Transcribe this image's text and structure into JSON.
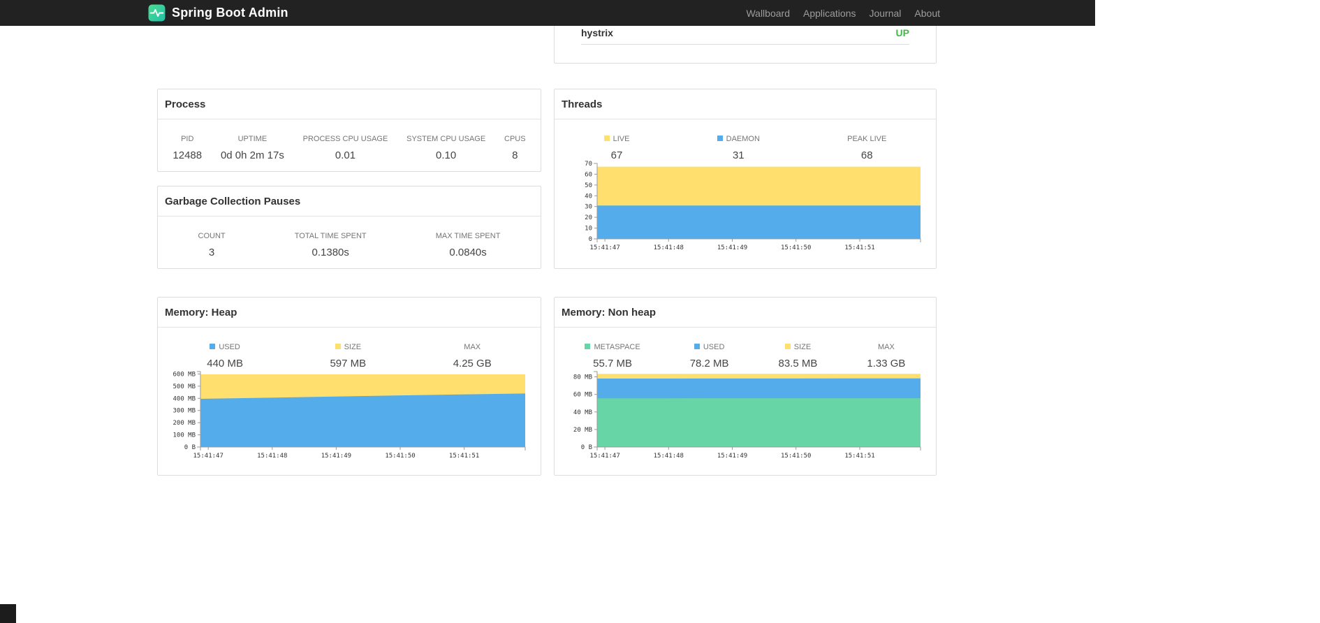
{
  "navbar": {
    "brand": "Spring Boot Admin",
    "brand_icon": "pulse-logo-icon",
    "links": [
      {
        "label": "Wallboard"
      },
      {
        "label": "Applications"
      },
      {
        "label": "Journal"
      },
      {
        "label": "About"
      }
    ]
  },
  "health": {
    "items": [
      {
        "name": "hystrix",
        "status": "UP"
      }
    ]
  },
  "colors": {
    "navbar_bg": "#222222",
    "status_up": "#43b749",
    "chart_blue": "#55aceb",
    "chart_yellow": "#ffe06e",
    "chart_green": "#67d5a6"
  },
  "panels": {
    "process": {
      "title": "Process",
      "metrics": [
        {
          "label": "PID",
          "value": "12488"
        },
        {
          "label": "UPTIME",
          "value": "0d 0h 2m 17s"
        },
        {
          "label": "PROCESS CPU USAGE",
          "value": "0.01"
        },
        {
          "label": "SYSTEM CPU USAGE",
          "value": "0.10"
        },
        {
          "label": "CPUS",
          "value": "8"
        }
      ]
    },
    "gc": {
      "title": "Garbage Collection Pauses",
      "metrics": [
        {
          "label": "COUNT",
          "value": "3"
        },
        {
          "label": "TOTAL TIME SPENT",
          "value": "0.1380s"
        },
        {
          "label": "MAX TIME SPENT",
          "value": "0.0840s"
        }
      ]
    },
    "threads": {
      "title": "Threads",
      "metrics": [
        {
          "label": "LIVE",
          "value": "67",
          "color": "#ffe06e"
        },
        {
          "label": "DAEMON",
          "value": "31",
          "color": "#55aceb"
        },
        {
          "label": "PEAK LIVE",
          "value": "68"
        }
      ]
    },
    "heap": {
      "title": "Memory: Heap",
      "metrics": [
        {
          "label": "USED",
          "value": "440 MB",
          "color": "#55aceb"
        },
        {
          "label": "SIZE",
          "value": "597 MB",
          "color": "#ffe06e"
        },
        {
          "label": "MAX",
          "value": "4.25 GB"
        }
      ]
    },
    "nonheap": {
      "title": "Memory: Non heap",
      "metrics": [
        {
          "label": "METASPACE",
          "value": "55.7 MB",
          "color": "#67d5a6"
        },
        {
          "label": "USED",
          "value": "78.2 MB",
          "color": "#55aceb"
        },
        {
          "label": "SIZE",
          "value": "83.5 MB",
          "color": "#ffe06e"
        },
        {
          "label": "MAX",
          "value": "1.33 GB"
        }
      ]
    }
  },
  "chart_data": [
    {
      "id": "threads",
      "type": "area",
      "title": "Threads",
      "x": [
        "15:41:47",
        "15:41:48",
        "15:41:49",
        "15:41:50",
        "15:41:51"
      ],
      "xlabel": "",
      "ylabel": "",
      "ylim": [
        0,
        70
      ],
      "y_ticks": [
        0,
        10,
        20,
        30,
        40,
        50,
        60,
        70
      ],
      "y_tick_labels": [
        "0",
        "10",
        "20",
        "30",
        "40",
        "50",
        "60",
        "70"
      ],
      "grid": false,
      "legend_position": "top",
      "series": [
        {
          "name": "LIVE",
          "color": "#ffe06e",
          "values": [
            67,
            67,
            67,
            67,
            67,
            67
          ]
        },
        {
          "name": "DAEMON",
          "color": "#55aceb",
          "values": [
            31,
            31,
            31,
            31,
            31,
            31
          ]
        }
      ]
    },
    {
      "id": "memory-heap",
      "type": "area",
      "title": "Memory: Heap",
      "x": [
        "15:41:47",
        "15:41:48",
        "15:41:49",
        "15:41:50",
        "15:41:51"
      ],
      "xlabel": "",
      "ylabel": "MB",
      "ylim": [
        0,
        620
      ],
      "y_ticks": [
        0,
        100,
        200,
        300,
        400,
        500,
        600
      ],
      "y_tick_labels": [
        "0 B",
        "100 MB",
        "200 MB",
        "300 MB",
        "400 MB",
        "500 MB",
        "600 MB"
      ],
      "grid": false,
      "legend_position": "top",
      "series": [
        {
          "name": "SIZE",
          "color": "#ffe06e",
          "values": [
            597,
            597,
            597,
            597,
            597,
            597
          ]
        },
        {
          "name": "USED",
          "color": "#55aceb",
          "values": [
            396,
            405,
            414,
            423,
            432,
            440
          ]
        }
      ]
    },
    {
      "id": "memory-nonheap",
      "type": "area",
      "title": "Memory: Non heap",
      "x": [
        "15:41:47",
        "15:41:48",
        "15:41:49",
        "15:41:50",
        "15:41:51"
      ],
      "xlabel": "",
      "ylabel": "MB",
      "ylim": [
        0,
        86
      ],
      "y_ticks": [
        0,
        20,
        40,
        60,
        80
      ],
      "y_tick_labels": [
        "0 B",
        "20 MB",
        "40 MB",
        "60 MB",
        "80 MB"
      ],
      "grid": false,
      "legend_position": "top",
      "series": [
        {
          "name": "SIZE",
          "color": "#ffe06e",
          "values": [
            83.4,
            83.4,
            83.5,
            83.5,
            83.5,
            83.5
          ]
        },
        {
          "name": "USED",
          "color": "#55aceb",
          "values": [
            78.0,
            78.0,
            78.1,
            78.1,
            78.2,
            78.2
          ]
        },
        {
          "name": "METASPACE",
          "color": "#67d5a6",
          "values": [
            55.6,
            55.6,
            55.7,
            55.7,
            55.7,
            55.7
          ]
        }
      ]
    }
  ]
}
